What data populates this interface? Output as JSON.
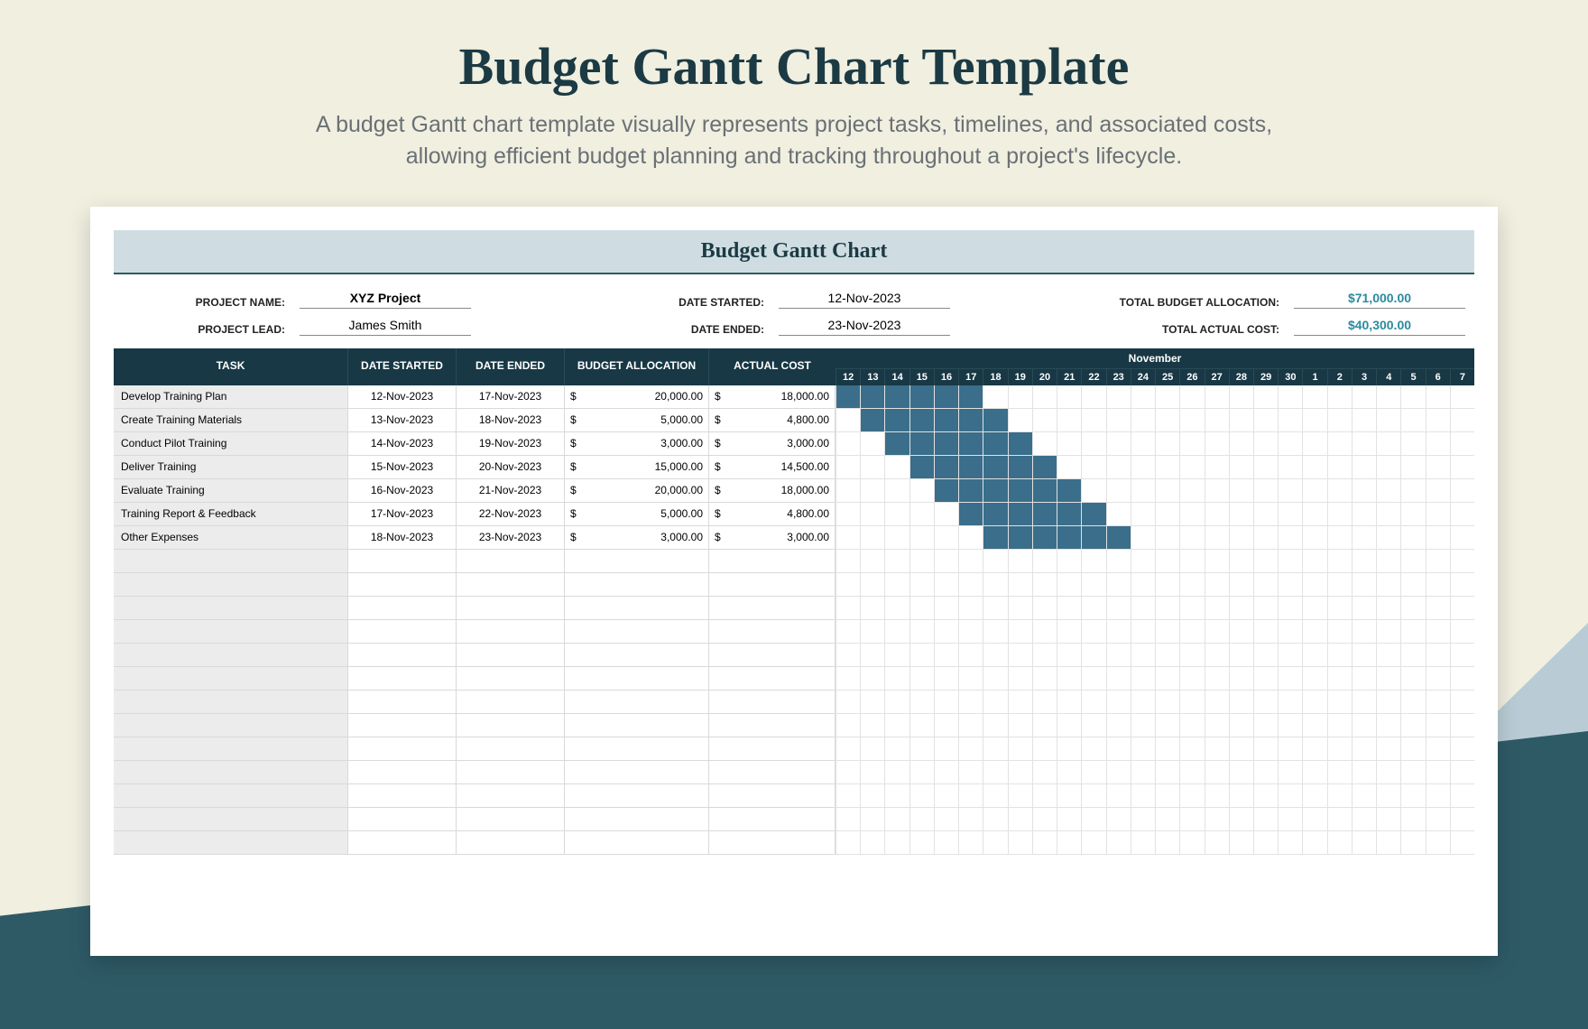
{
  "title": "Budget Gantt Chart Template",
  "description_l1": "A budget Gantt chart template visually represents project tasks, timelines, and associated costs,",
  "description_l2": "allowing efficient budget planning and tracking throughout a project's lifecycle.",
  "banner": "Budget Gantt Chart",
  "meta": {
    "project_name_label": "PROJECT NAME:",
    "project_name": "XYZ Project",
    "project_lead_label": "PROJECT LEAD:",
    "project_lead": "James Smith",
    "date_started_label": "DATE STARTED:",
    "date_started": "12-Nov-2023",
    "date_ended_label": "DATE ENDED:",
    "date_ended": "23-Nov-2023",
    "total_budget_label": "TOTAL BUDGET ALLOCATION:",
    "total_budget": "$71,000.00",
    "total_actual_label": "TOTAL ACTUAL COST:",
    "total_actual": "$40,300.00"
  },
  "headers": {
    "task": "TASK",
    "date_started": "DATE STARTED",
    "date_ended": "DATE ENDED",
    "budget_allocation": "BUDGET ALLOCATION",
    "actual_cost": "ACTUAL COST",
    "month": "November"
  },
  "days": [
    12,
    13,
    14,
    15,
    16,
    17,
    18,
    19,
    20,
    21,
    22,
    23,
    24,
    25,
    26,
    27,
    28,
    29,
    30,
    1,
    2,
    3,
    4,
    5,
    6,
    7
  ],
  "currency": "$",
  "tasks": [
    {
      "name": "Develop Training Plan",
      "ds": "12-Nov-2023",
      "de": "17-Nov-2023",
      "ba": "20,000.00",
      "ac": "18,000.00",
      "start": 12,
      "end": 17
    },
    {
      "name": "Create Training Materials",
      "ds": "13-Nov-2023",
      "de": "18-Nov-2023",
      "ba": "5,000.00",
      "ac": "4,800.00",
      "start": 13,
      "end": 18
    },
    {
      "name": "Conduct Pilot Training",
      "ds": "14-Nov-2023",
      "de": "19-Nov-2023",
      "ba": "3,000.00",
      "ac": "3,000.00",
      "start": 14,
      "end": 19
    },
    {
      "name": "Deliver Training",
      "ds": "15-Nov-2023",
      "de": "20-Nov-2023",
      "ba": "15,000.00",
      "ac": "14,500.00",
      "start": 15,
      "end": 20
    },
    {
      "name": "Evaluate Training",
      "ds": "16-Nov-2023",
      "de": "21-Nov-2023",
      "ba": "20,000.00",
      "ac": "18,000.00",
      "start": 16,
      "end": 21
    },
    {
      "name": "Training Report & Feedback",
      "ds": "17-Nov-2023",
      "de": "22-Nov-2023",
      "ba": "5,000.00",
      "ac": "4,800.00",
      "start": 17,
      "end": 22
    },
    {
      "name": "Other Expenses",
      "ds": "18-Nov-2023",
      "de": "23-Nov-2023",
      "ba": "3,000.00",
      "ac": "3,000.00",
      "start": 18,
      "end": 23
    }
  ],
  "empty_rows": 13,
  "chart_data": {
    "type": "gantt",
    "title": "Budget Gantt Chart",
    "x_axis": {
      "label": "November",
      "start": 12,
      "days": [
        12,
        13,
        14,
        15,
        16,
        17,
        18,
        19,
        20,
        21,
        22,
        23,
        24,
        25,
        26,
        27,
        28,
        29,
        30,
        1,
        2,
        3,
        4,
        5,
        6,
        7
      ]
    },
    "series": [
      {
        "name": "Develop Training Plan",
        "start": 12,
        "end": 17,
        "budget": 20000,
        "actual": 18000
      },
      {
        "name": "Create Training Materials",
        "start": 13,
        "end": 18,
        "budget": 5000,
        "actual": 4800
      },
      {
        "name": "Conduct Pilot Training",
        "start": 14,
        "end": 19,
        "budget": 3000,
        "actual": 3000
      },
      {
        "name": "Deliver Training",
        "start": 15,
        "end": 20,
        "budget": 15000,
        "actual": 14500
      },
      {
        "name": "Evaluate Training",
        "start": 16,
        "end": 21,
        "budget": 20000,
        "actual": 18000
      },
      {
        "name": "Training Report & Feedback",
        "start": 17,
        "end": 22,
        "budget": 5000,
        "actual": 4800
      },
      {
        "name": "Other Expenses",
        "start": 18,
        "end": 23,
        "budget": 3000,
        "actual": 3000
      }
    ],
    "totals": {
      "budget": 71000,
      "actual": 40300
    }
  }
}
